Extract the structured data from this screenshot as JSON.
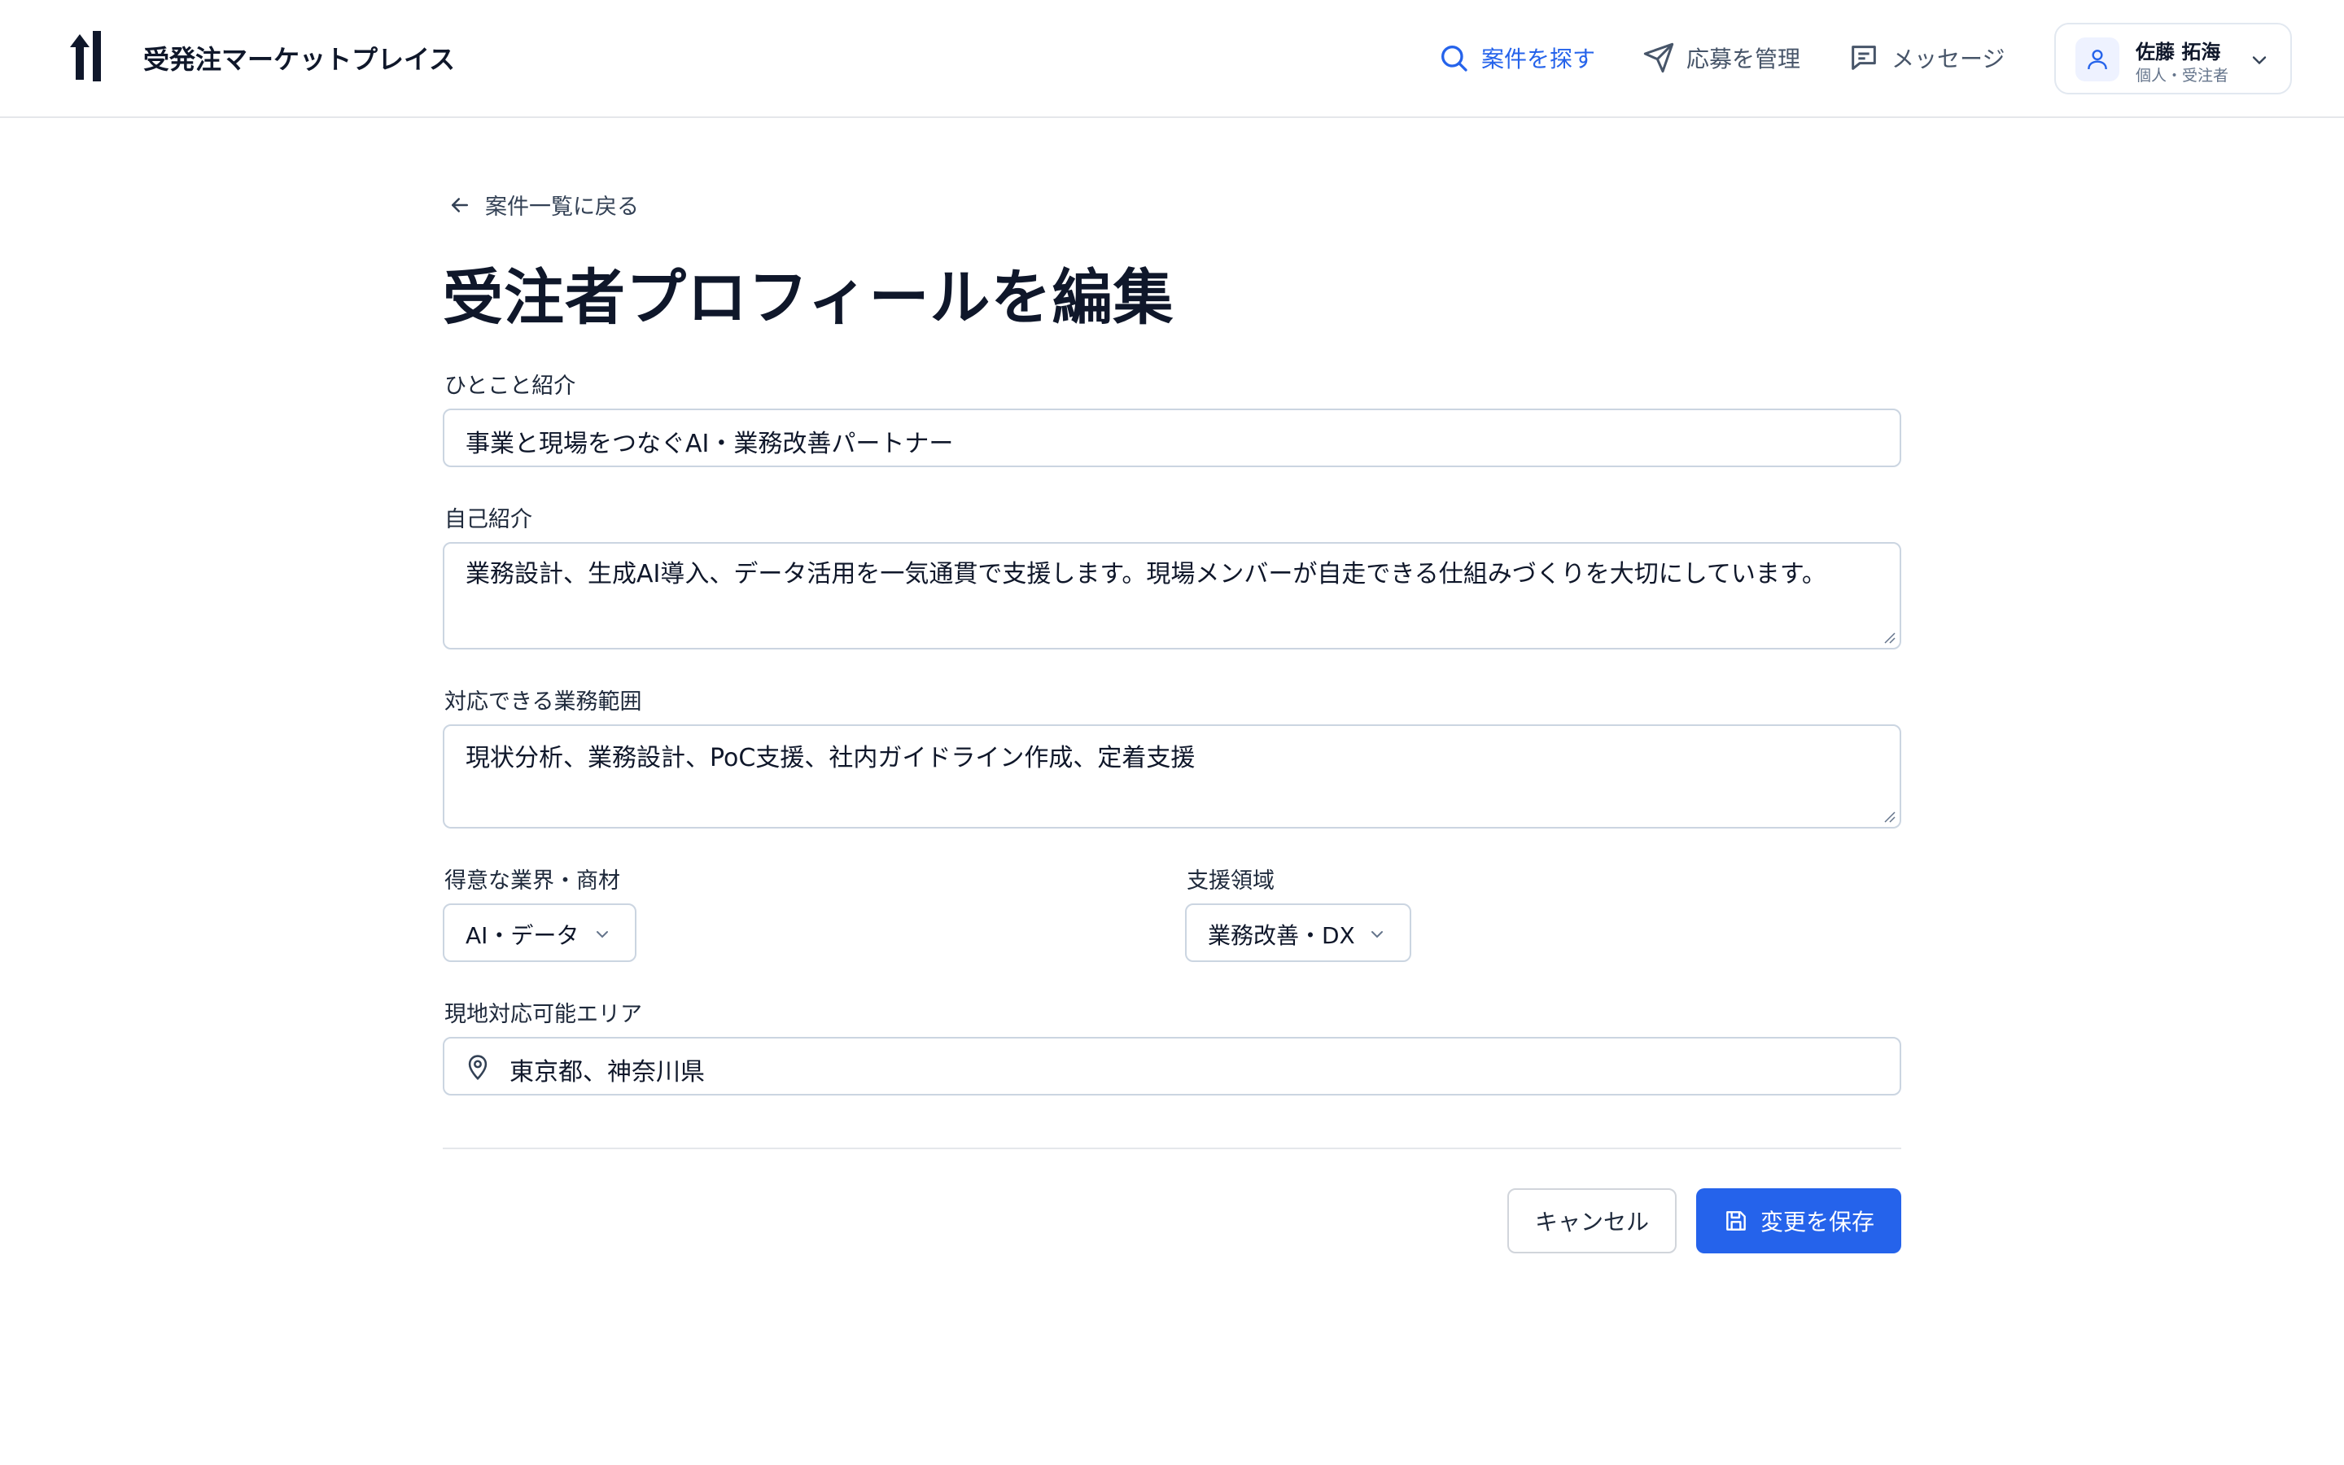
{
  "header": {
    "app_name": "受発注マーケットプレイス",
    "nav": [
      {
        "label": "案件を探す",
        "icon": "search-icon",
        "active": true
      },
      {
        "label": "応募を管理",
        "icon": "send-icon",
        "active": false
      },
      {
        "label": "メッセージ",
        "icon": "message-icon",
        "active": false
      }
    ],
    "user": {
      "name": "佐藤 拓海",
      "role": "個人・受注者"
    }
  },
  "main": {
    "back_label": "案件一覧に戻る",
    "title": "受注者プロフィールを編集",
    "fields": {
      "tagline": {
        "label": "ひとこと紹介",
        "value": "事業と現場をつなぐAI・業務改善パートナー"
      },
      "bio": {
        "label": "自己紹介",
        "value": "業務設計、生成AI導入、データ活用を一気通貫で支援します。現場メンバーが自走できる仕組みづくりを大切にしています。"
      },
      "scope": {
        "label": "対応できる業務範囲",
        "value": "現状分析、業務設計、PoC支援、社内ガイドライン作成、定着支援"
      },
      "industry": {
        "label": "得意な業界・商材",
        "value": "AI・データ"
      },
      "support_area": {
        "label": "支援領域",
        "value": "業務改善・DX"
      },
      "onsite_area": {
        "label": "現地対応可能エリア",
        "value": "東京都、神奈川県"
      }
    },
    "actions": {
      "cancel": "キャンセル",
      "save": "変更を保存"
    }
  },
  "colors": {
    "accent": "#2563eb",
    "text": "#0f172a",
    "border": "#cbd5e1"
  }
}
